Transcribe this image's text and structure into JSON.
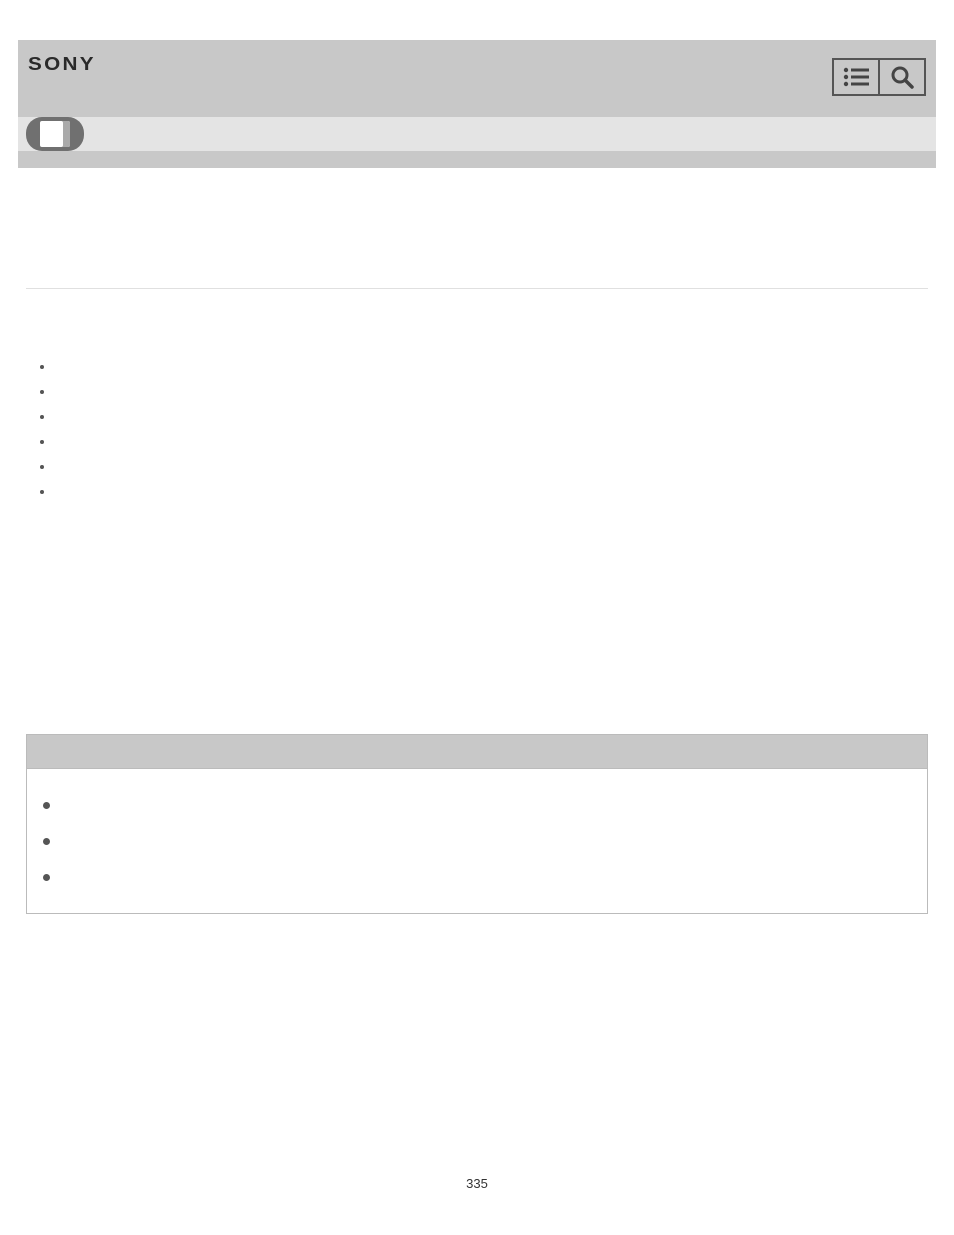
{
  "header": {
    "brand": "SONY"
  },
  "list": {
    "items": [
      {
        "label": ""
      },
      {
        "label": ""
      },
      {
        "label": ""
      },
      {
        "label": ""
      },
      {
        "label": ""
      },
      {
        "label": ""
      }
    ]
  },
  "noteBox": {
    "items": [
      {
        "label": ""
      },
      {
        "label": ""
      },
      {
        "label": ""
      }
    ]
  },
  "pageNumber": "335"
}
